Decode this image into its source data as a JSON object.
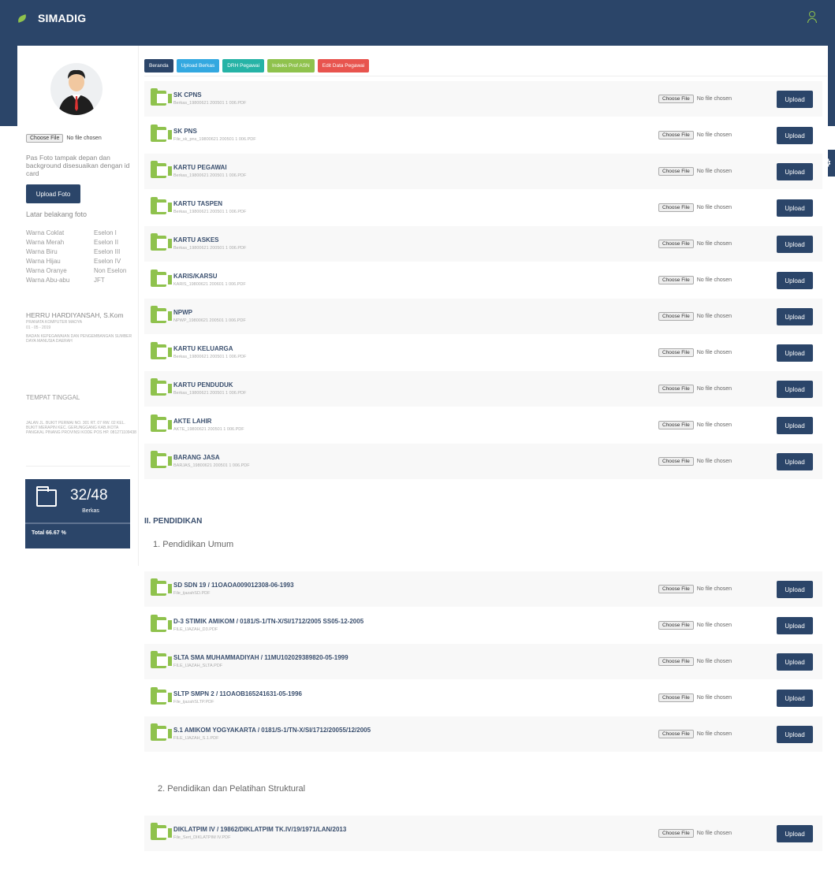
{
  "app": {
    "title": "SIMADIG"
  },
  "colors": {
    "primary": "#2b4569",
    "accent": "#8fc24d"
  },
  "icons": {
    "brand": "leaf-icon",
    "user": "user-icon",
    "settings": "gear-icon",
    "document": "folder-icon"
  },
  "sidebar": {
    "choose_file": "Choose File",
    "no_file": "No file chosen",
    "photo_note": "Pas Foto tampak depan dan background disesuaikan dengan id card",
    "upload_photo": "Upload Foto",
    "bg_label": "Latar belakang foto",
    "legend": [
      {
        "color": "Warna Coklat",
        "level": "Eselon I"
      },
      {
        "color": "Warna Merah",
        "level": "Eselon II"
      },
      {
        "color": "Warna Biru",
        "level": "Eselon III"
      },
      {
        "color": "Warna Hijau",
        "level": "Eselon IV"
      },
      {
        "color": "Warna Oranye",
        "level": "Non Eselon"
      },
      {
        "color": "Warna Abu-abu",
        "level": "JFT"
      }
    ],
    "name": "HERRU HARDIYANSAH, S.Kom",
    "position": "PRANATA KOMPUTER MADYA",
    "date": "01 - 05 - 2019",
    "agency": "BADAN KEPEGAWAIAN DAN PENGEMBANGAN SUMBER DAYA MANUSIA DAERAH",
    "residence_title": "TEMPAT TINGGAL",
    "address": "JALAN JL. BUKIT PERMAI NO. 301 RT. 07 RW. 02 KEL. BUKIT MERAPIN KEC. GERUNGGANG KAB./KOTA PANGKAL PINANG PROVINSI KODE POS HP. 081271109438",
    "stat_count": "32/48",
    "stat_label": "Berkas",
    "stat_total": "Total 66.67 %"
  },
  "tabs": [
    {
      "label": "Beranda",
      "color": "#2b4569"
    },
    {
      "label": "Upload Berkas",
      "color": "#33a8e0"
    },
    {
      "label": "DRH Pegawai",
      "color": "#26b3a6"
    },
    {
      "label": "Indeks Prof ASN",
      "color": "#8fc24d"
    },
    {
      "label": "Edit Data Pegawai",
      "color": "#e8544e"
    }
  ],
  "file_input": {
    "button": "Choose File",
    "status": "No file chosen"
  },
  "upload_label": "Upload",
  "documents": [
    {
      "title": "SK CPNS",
      "file": "Berkas_19800621 200501 1 006.PDF"
    },
    {
      "title": "SK PNS",
      "file": "File_sk_pns_19800621 200501 1 006.PDF"
    },
    {
      "title": "KARTU PEGAWAI",
      "file": "Berkas_19800621 200501 1 006.PDF"
    },
    {
      "title": "KARTU TASPEN",
      "file": "Berkas_19800621 200501 1 006.PDF"
    },
    {
      "title": "KARTU ASKES",
      "file": "Berkas_19800621 200501 1 006.PDF"
    },
    {
      "title": "KARIS/KARSU",
      "file": "KARIS_19800621 200601 1 006.PDF"
    },
    {
      "title": "NPWP",
      "file": "NPWP_19800621 200501 1 006.PDF"
    },
    {
      "title": "KARTU KELUARGA",
      "file": "Berkas_19800621 200501 1 006.PDF"
    },
    {
      "title": "KARTU PENDUDUK",
      "file": "Berkas_19800621 200501 1 006.PDF"
    },
    {
      "title": "AKTE LAHIR",
      "file": "AKTE_19800621 200501 1 006.PDF"
    },
    {
      "title": "BARANG JASA",
      "file": "BARJAS_19800621 200501 1 006.PDF"
    }
  ],
  "education": {
    "section_title": "II. PENDIDIKAN",
    "general_title": "1. Pendidikan Umum",
    "general": [
      {
        "title": "SD SDN 19 / 11OAOA009012308-06-1993",
        "file": "File_ijazahSD.PDF"
      },
      {
        "title": "D-3 STIMIK AMIKOM / 0181/S-1/TN-X/SI/1712/2005 SS05-12-2005",
        "file": "FILE_IJAZAH_D3.PDF"
      },
      {
        "title": "SLTA SMA MUHAMMADIYAH / 11MU102029389820-05-1999",
        "file": "FILE_IJAZAH_SLTA.PDF"
      },
      {
        "title": "SLTP SMPN 2 / 11OAOB165241631-05-1996",
        "file": "File_ijazahSLTP.PDF"
      },
      {
        "title": "S.1 AMIKOM YOGYAKARTA / 0181/S-1/TN-X/SI/1712/20055/12/2005",
        "file": "FILE_IJAZAH_S.1.PDF"
      }
    ],
    "structural_title": "2. Pendidikan dan Pelatihan Struktural",
    "structural": [
      {
        "title": "DIKLATPIM IV / 19862/DIKLATPIM TK.IV/19/1971/LAN/2013",
        "file": "File_Sert_DIKLATPIM IV.PDF"
      }
    ]
  }
}
